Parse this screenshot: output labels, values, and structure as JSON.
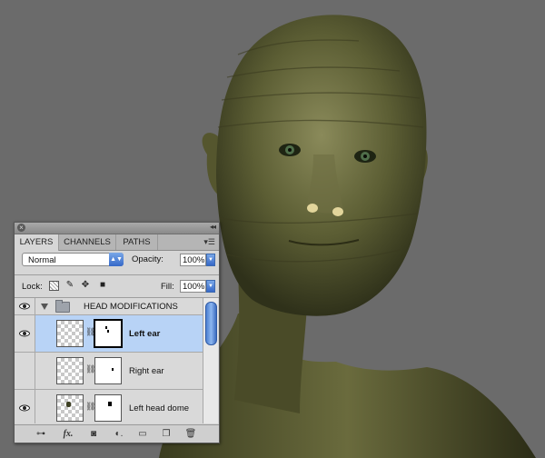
{
  "panel": {
    "tabs": [
      "LAYERS",
      "CHANNELS",
      "PATHS"
    ],
    "blend_mode": "Normal",
    "opacity_label": "Opacity:",
    "opacity_value": "100%",
    "lock_label": "Lock:",
    "fill_label": "Fill:",
    "fill_value": "100%"
  },
  "layers": [
    {
      "name": "HEAD MODIFICATIONS",
      "type": "group",
      "visible": true,
      "expanded": true
    },
    {
      "name": "Left ear",
      "type": "layer",
      "visible": true,
      "selected": true
    },
    {
      "name": "Right ear",
      "type": "layer",
      "visible": false,
      "selected": false
    },
    {
      "name": "Left head dome",
      "type": "layer",
      "visible": true,
      "selected": false
    }
  ],
  "bottom_icons": [
    "link-layers-icon",
    "fx-icon",
    "add-mask-icon",
    "adjustment-layer-icon",
    "new-group-icon",
    "new-layer-icon",
    "trash-icon"
  ],
  "colors": {
    "background": "#6b6b6b",
    "selected_row": "#b8d3f6",
    "panel": "#d6d6d6",
    "accent_blue": "#3568c8"
  }
}
